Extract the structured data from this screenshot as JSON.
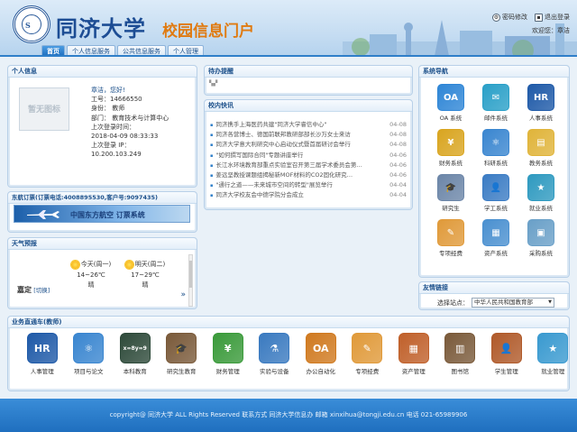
{
  "header": {
    "logo_name": "同济大学",
    "portal_name": "校园信息门户",
    "password_link": "密码修改",
    "logout_link": "退出登录",
    "welcome": "欢迎您：章洁"
  },
  "tabs": [
    {
      "label": "首页",
      "active": true
    },
    {
      "label": "个人信息服务",
      "active": false
    },
    {
      "label": "公共信息服务",
      "active": false
    },
    {
      "label": "个人管理",
      "active": false
    }
  ],
  "personal": {
    "title": "个人信息",
    "photo_placeholder": "暂无图标",
    "hello": "章洁，您好!",
    "id_line": "工号：14666550",
    "role_line": "身份：  教师",
    "dept_line": "部门：  教育技术与计算中心",
    "last_login_label": "上次登录时间：",
    "last_login_time": "2018-04-09 08:33:33",
    "last_ip_label": "上次登录 IP：",
    "last_ip": "10.200.103.249"
  },
  "airline": {
    "title": "东航订票(订票电话:4008895530,客户号:9097435)",
    "banner_text": "中国东方航空 订票系统"
  },
  "weather": {
    "title": "天气预报",
    "city": "嘉定",
    "switch_label": "[切换]",
    "today_label": "今天(周一)",
    "today_temp": "14~26℃",
    "today_desc": "晴",
    "tomorrow_label": "明天(周二)",
    "tomorrow_temp": "17~29℃",
    "tomorrow_desc": "晴",
    "more": "»"
  },
  "todo": {
    "title": "待办提醒"
  },
  "news": {
    "title": "校内快讯",
    "items": [
      {
        "title": "同济携手上海医药共建\"同济大学睿信中心\"",
        "date": "04-08"
      },
      {
        "title": "同济各营博士、德国前联邦教研部部长沙万女士来访",
        "date": "04-08"
      },
      {
        "title": "同济大学意大利研究中心启动仪式暨首届研讨会举行",
        "date": "04-08"
      },
      {
        "title": "\"如何撰写国际合同\"专题讲座举行",
        "date": "04-06"
      },
      {
        "title": "长江水环境教育部重点实验室召开第三届学术委员会第…",
        "date": "04-06"
      },
      {
        "title": "姜远坚教授课题组揭秘新MOF材料的CO2固化研究…",
        "date": "04-06"
      },
      {
        "title": "\"通行之道——未来城市空间的转型\"展览举行",
        "date": "04-04"
      },
      {
        "title": "同济大学校友会中德学院分会成立",
        "date": "04-04"
      }
    ]
  },
  "system_nav": {
    "title": "系统导航",
    "items": [
      {
        "label": "OA 系统",
        "icon": "oa-icon",
        "glyph": "OA",
        "color": "#2f86d6"
      },
      {
        "label": "邮件系统",
        "icon": "mail-icon",
        "glyph": "✉",
        "color": "#2aa0c8"
      },
      {
        "label": "人事系统",
        "icon": "hr-icon",
        "glyph": "HR",
        "color": "#1f5aa8"
      },
      {
        "label": "财务系统",
        "icon": "finance-icon",
        "glyph": "¥",
        "color": "#d9a520"
      },
      {
        "label": "科研系统",
        "icon": "research-icon",
        "glyph": "⚛",
        "color": "#3a86d0"
      },
      {
        "label": "教务系统",
        "icon": "academic-icon",
        "glyph": "▤",
        "color": "#e0b43a"
      },
      {
        "label": "研究生",
        "icon": "graduate-icon",
        "glyph": "🎓",
        "color": "#6c86a8"
      },
      {
        "label": "学工系统",
        "icon": "student-affairs-icon",
        "glyph": "👤",
        "color": "#3b7cc4"
      },
      {
        "label": "就业系统",
        "icon": "employment-icon",
        "glyph": "★",
        "color": "#2f9ac0"
      },
      {
        "label": "专项经费",
        "icon": "funding-icon",
        "glyph": "✎",
        "color": "#e09a3a"
      },
      {
        "label": "资产系统",
        "icon": "asset-icon",
        "glyph": "▦",
        "color": "#4a90d0"
      },
      {
        "label": "采购系统",
        "icon": "purchase-icon",
        "glyph": "▣",
        "color": "#6aa0c8"
      }
    ]
  },
  "friend_links": {
    "title": "友情链接",
    "select_label": "选择站点：",
    "selected": "中华人民共和国教育部"
  },
  "business": {
    "title": "业务直通车(教师)",
    "items": [
      {
        "label": "人事管理",
        "icon": "hr-icon",
        "glyph": "HR",
        "color": "#1f5aa8"
      },
      {
        "label": "项目与论文",
        "icon": "research-icon",
        "glyph": "⚛",
        "color": "#3a86d0"
      },
      {
        "label": "本科教育",
        "icon": "math-icon",
        "glyph": "x=8y=9",
        "color": "#2e4a3a"
      },
      {
        "label": "研究生教育",
        "icon": "graduate-icon",
        "glyph": "🎓",
        "color": "#7a5a3a"
      },
      {
        "label": "财务管理",
        "icon": "finance-icon",
        "glyph": "¥",
        "color": "#3a9a3a"
      },
      {
        "label": "实验与设备",
        "icon": "lab-icon",
        "glyph": "⚗",
        "color": "#3a7ac0"
      },
      {
        "label": "办公自动化",
        "icon": "oa-icon",
        "glyph": "OA",
        "color": "#d07a20"
      },
      {
        "label": "专项经费",
        "icon": "funding-icon",
        "glyph": "✎",
        "color": "#e09a3a"
      },
      {
        "label": "资产管理",
        "icon": "asset-icon",
        "glyph": "▦",
        "color": "#c0602a"
      },
      {
        "label": "图书馆",
        "icon": "library-icon",
        "glyph": "▥",
        "color": "#7a5a3a"
      },
      {
        "label": "学生管理",
        "icon": "student-icon",
        "glyph": "👤",
        "color": "#b05a2a"
      },
      {
        "label": "就业管理",
        "icon": "employment-icon",
        "glyph": "★",
        "color": "#3a9ad0"
      }
    ]
  },
  "footer": {
    "text": "copyright@ 同济大学  ALL Rights Reserved 联系方式  同济大学信息办 邮箱 xinxihua@tongji.edu.cn 电话 021-65989906"
  }
}
